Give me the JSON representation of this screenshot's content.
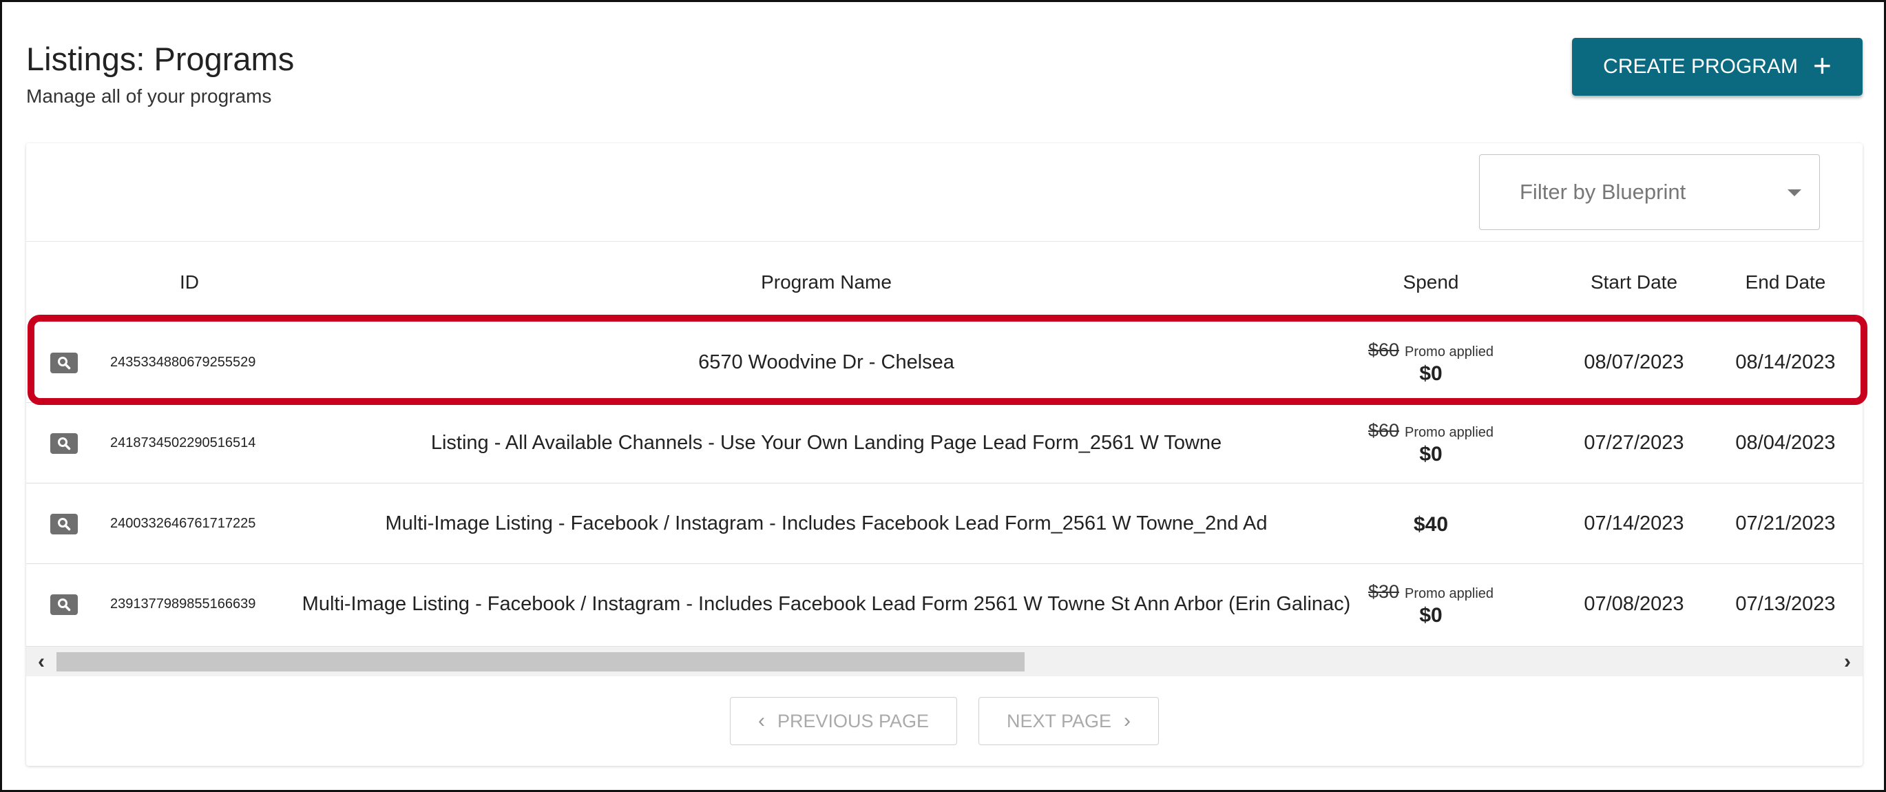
{
  "header": {
    "title": "Listings: Programs",
    "subtitle": "Manage all of your programs",
    "create_label": "CREATE PROGRAM",
    "create_icon": "+"
  },
  "filter": {
    "placeholder": "Filter by Blueprint"
  },
  "table": {
    "columns": {
      "id": "ID",
      "name": "Program Name",
      "spend": "Spend",
      "start": "Start Date",
      "end": "End Date"
    },
    "rows": [
      {
        "id": "2435334880679255529",
        "name": "6570 Woodvine Dr - Chelsea",
        "spend_old": "$60",
        "promo": "Promo applied",
        "spend": "$0",
        "start": "08/07/2023",
        "end": "08/14/2023"
      },
      {
        "id": "2418734502290516514",
        "name": "Listing - All Available Channels - Use Your Own Landing Page Lead Form_2561 W Towne",
        "spend_old": "$60",
        "promo": "Promo applied",
        "spend": "$0",
        "start": "07/27/2023",
        "end": "08/04/2023"
      },
      {
        "id": "2400332646761717225",
        "name": "Multi-Image Listing - Facebook / Instagram - Includes Facebook Lead Form_2561 W Towne_2nd Ad",
        "spend_old": "",
        "promo": "",
        "spend": "$40",
        "start": "07/14/2023",
        "end": "07/21/2023"
      },
      {
        "id": "2391377989855166639",
        "name": "Multi-Image Listing - Facebook / Instagram - Includes Facebook Lead Form 2561 W Towne St Ann Arbor (Erin Galinac)",
        "spend_old": "$30",
        "promo": "Promo applied",
        "spend": "$0",
        "start": "07/08/2023",
        "end": "07/13/2023"
      }
    ]
  },
  "scrollbar": {
    "left_arrow": "‹",
    "right_arrow": "›"
  },
  "pagination": {
    "prev_label": "PREVIOUS PAGE",
    "next_label": "NEXT PAGE"
  },
  "colors": {
    "primary": "#0b6a80",
    "highlight": "#c8001e"
  }
}
